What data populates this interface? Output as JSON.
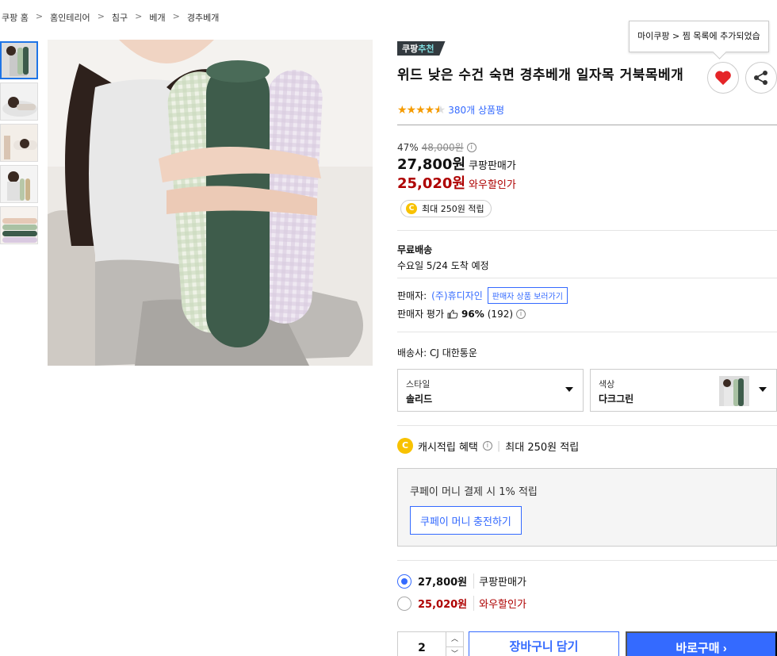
{
  "breadcrumb": [
    "쿠팡 홈",
    "홈인테리어",
    "침구",
    "베개",
    "경추베개"
  ],
  "breadcrumb_sep": ">",
  "badge": {
    "brand": "쿠팡",
    "accent": "추천"
  },
  "title": "위드 낮은 수건 숙면 경추베개 일자목 거북목베개",
  "tooltip": "마이쿠팡 > 찜 목록에 추가되었습",
  "rating": {
    "stars": 4.5,
    "review_count": "380개 상품평"
  },
  "price": {
    "discount_rate": "47%",
    "original": "48,000원",
    "coupang_price": "27,800원",
    "coupang_label": "쿠팡판매가",
    "wow_price": "25,020원",
    "wow_label": "와우할인가"
  },
  "cash_pill": "최대 250원 적립",
  "shipping": {
    "title": "무료배송",
    "arrival": "수요일 5/24 도착 예정"
  },
  "seller": {
    "label": "판매자:",
    "name": "(주)휴디자인",
    "button": "판매자 상품 보러가기"
  },
  "seller_eval": {
    "label": "판매자 평가",
    "percent": "96%",
    "count": "(192)"
  },
  "carrier": "배송사: CJ 대한통운",
  "options": {
    "style": {
      "label": "스타일",
      "value": "솔리드"
    },
    "color": {
      "label": "색상",
      "value": "다크그린"
    }
  },
  "cash_benefit": {
    "label": "캐시적립 혜택",
    "value": "최대 250원 적립"
  },
  "coupay": {
    "text": "쿠페이 머니 결제 시 1% 적립",
    "button": "쿠페이 머니 충전하기"
  },
  "radio_prices": [
    {
      "amount": "27,800원",
      "label": "쿠팡판매가",
      "checked": true
    },
    {
      "amount": "25,020원",
      "label": "와우할인가",
      "checked": false
    }
  ],
  "quantity": "2",
  "cart_button": "장바구니 담기",
  "buy_button": "바로구매",
  "colors": {
    "accent": "#346aff",
    "sale": "#ae0000",
    "badge_bg": "#333a3f",
    "badge_accent": "#7fdcde",
    "star": "#f59b00",
    "coin": "#f8c200",
    "heart": "#e52528"
  }
}
